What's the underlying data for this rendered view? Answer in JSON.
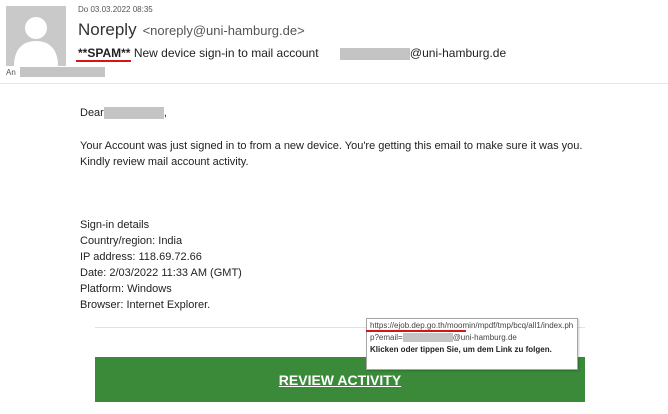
{
  "header": {
    "avatar_icon": "person-silhouette-icon",
    "date": "Do 03.03.2022 08:35",
    "sender_name": "Noreply",
    "sender_address": "<noreply@uni-hamburg.de>",
    "subject_spam_tag": "**SPAM**",
    "subject_text": "New device sign-in to mail account",
    "subject_recipient_domain": "@uni-hamburg.de",
    "to_label": "An"
  },
  "body": {
    "greeting": "Dear",
    "greeting_suffix": ",",
    "paragraph": "Your Account was just signed in to from a new device. You're getting this email to make sure it was you. Kindly review mail account activity.",
    "details_title": "Sign-in details",
    "country": "Country/region: India",
    "ip": "IP address: 118.69.72.66",
    "date": "Date: 2/03/2022 11:33 AM (GMT)",
    "platform": "Platform: Windows",
    "browser": "Browser: Internet Explorer."
  },
  "tooltip": {
    "url_start": "https://ejob.dep.go.th/moomin/mpdf/tmp/bcq/all1/index.php?email=",
    "url_end": "@uni-hamburg.de",
    "hint": "Klicken oder tippen Sie, um dem Link zu folgen."
  },
  "button": {
    "label": "REVIEW ACTIVITY"
  },
  "colors": {
    "banner": "#3a8a3a",
    "annotation_underline": "#d01818",
    "redaction": "#c4c4c4"
  }
}
